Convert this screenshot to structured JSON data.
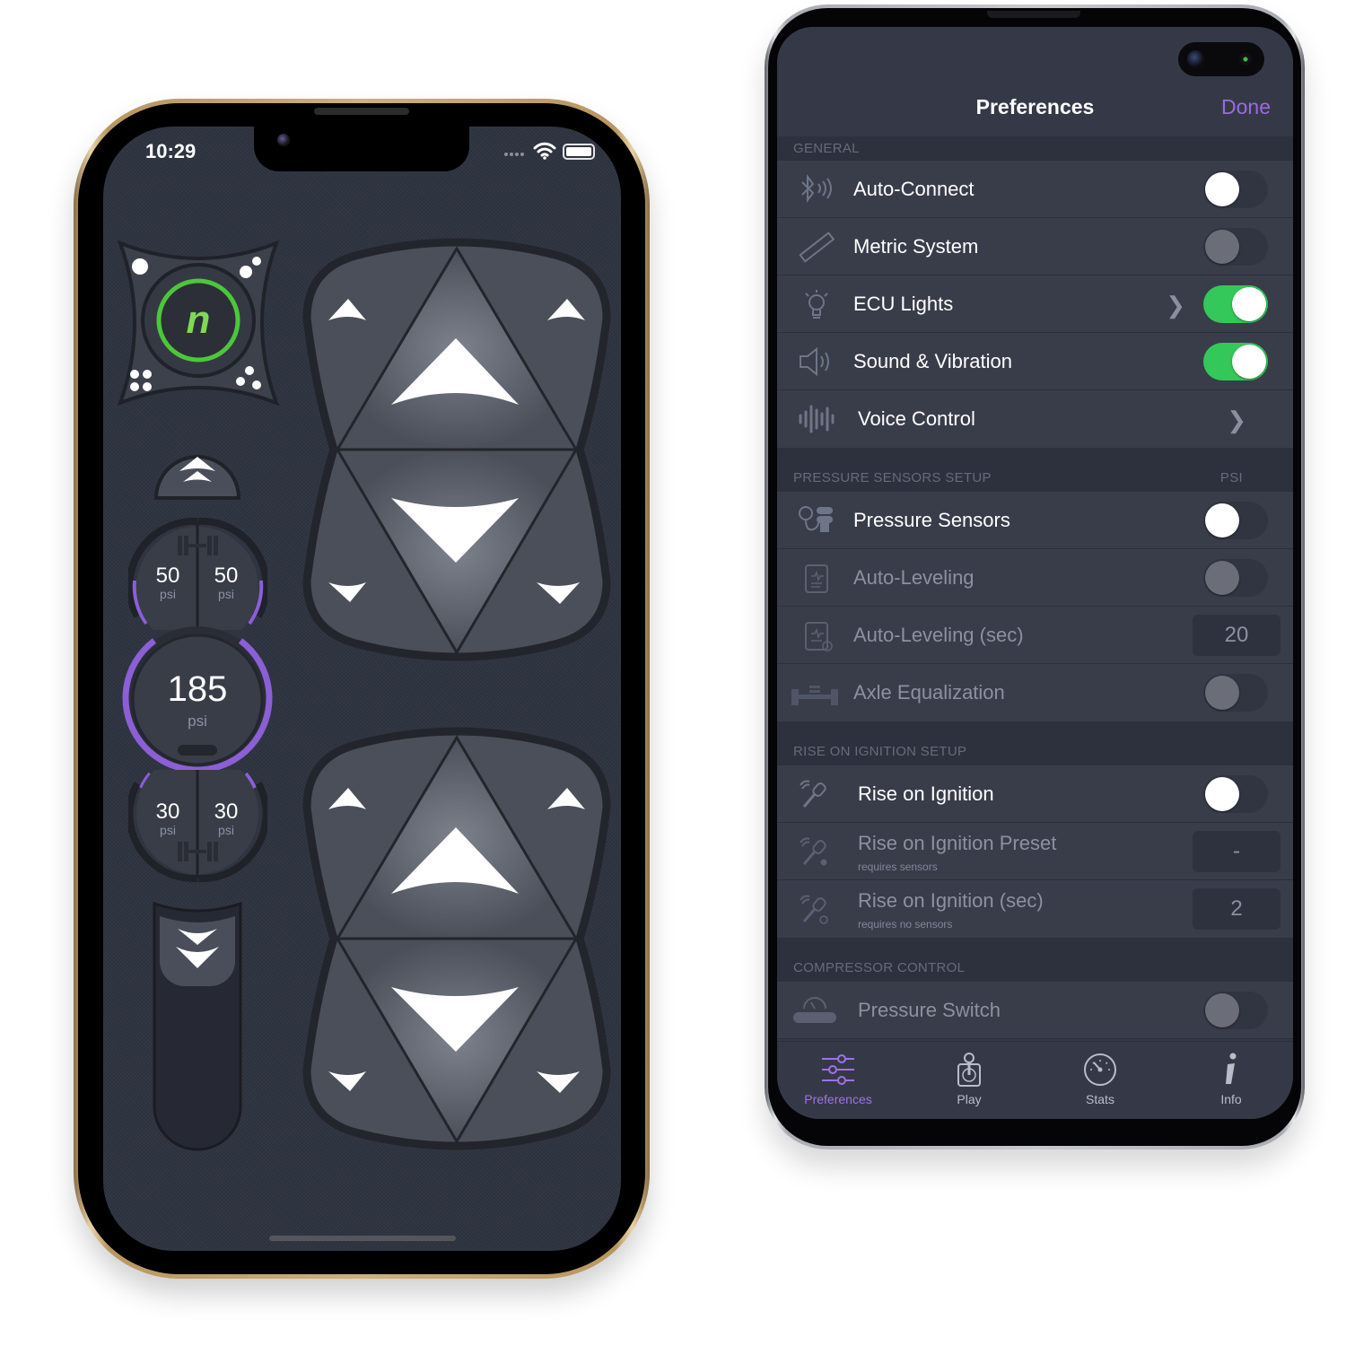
{
  "left_phone": {
    "status_bar": {
      "time": "10:29"
    },
    "logo_letter": "n",
    "front_left_pressure": {
      "value": "50",
      "unit": "psi"
    },
    "front_right_pressure": {
      "value": "50",
      "unit": "psi"
    },
    "tank_pressure": {
      "value": "185",
      "unit": "psi"
    },
    "rear_left_pressure": {
      "value": "30",
      "unit": "psi"
    },
    "rear_right_pressure": {
      "value": "30",
      "unit": "psi"
    },
    "accent_color": "#8b5fd6",
    "logo_ring_color": "#4cc73a"
  },
  "right_phone": {
    "nav": {
      "title": "Preferences",
      "done_label": "Done"
    },
    "sections": [
      {
        "header": "GENERAL",
        "header_right": "",
        "rows": [
          {
            "label": "Auto-Connect",
            "icon": "bluetooth-icon",
            "control": "toggle",
            "state": "off",
            "enabled": true
          },
          {
            "label": "Metric System",
            "icon": "ruler-icon",
            "control": "toggle",
            "state": "off",
            "enabled": false
          },
          {
            "label": "ECU Lights",
            "icon": "lightbulb-icon",
            "control": "toggle",
            "state": "on",
            "chevron": true,
            "enabled": true
          },
          {
            "label": "Sound & Vibration",
            "icon": "speaker-icon",
            "control": "toggle",
            "state": "on",
            "enabled": true
          },
          {
            "label": "Voice Control",
            "icon": "waveform-icon",
            "control": "chevron",
            "enabled": true
          }
        ]
      },
      {
        "header": "PRESSURE SENSORS SETUP",
        "header_right": "PSI",
        "rows": [
          {
            "label": "Pressure Sensors",
            "icon": "pressure-sensor-icon",
            "control": "toggle",
            "state": "off",
            "enabled": true
          },
          {
            "label": "Auto-Leveling",
            "icon": "clipboard-icon",
            "control": "toggle",
            "state": "off",
            "enabled": false
          },
          {
            "label": "Auto-Leveling (sec)",
            "icon": "clipboard-timer-icon",
            "control": "value",
            "value": "20",
            "enabled": false
          },
          {
            "label": "Axle Equalization",
            "icon": "axle-icon",
            "control": "toggle",
            "state": "off",
            "enabled": false
          }
        ]
      },
      {
        "header": "RISE ON IGNITION SETUP",
        "header_right": "",
        "rows": [
          {
            "label": "Rise on Ignition",
            "icon": "key-icon",
            "control": "toggle",
            "state": "off",
            "enabled": true
          },
          {
            "label": "Rise on Ignition Preset",
            "sublabel": "requires sensors",
            "icon": "key-dot-icon",
            "control": "value",
            "value": "-",
            "enabled": false
          },
          {
            "label": "Rise on Ignition (sec)",
            "sublabel": "requires no sensors",
            "icon": "key-timer-icon",
            "control": "value",
            "value": "2",
            "enabled": false
          }
        ]
      },
      {
        "header": "COMPRESSOR CONTROL",
        "header_right": "",
        "rows": [
          {
            "label": "Pressure Switch",
            "icon": "compressor-icon",
            "control": "toggle",
            "state": "off",
            "enabled": false
          }
        ]
      }
    ],
    "tabs": [
      {
        "label": "Preferences",
        "icon": "sliders-icon",
        "active": true
      },
      {
        "label": "Play",
        "icon": "joystick-icon",
        "active": false
      },
      {
        "label": "Stats",
        "icon": "gauge-icon",
        "active": false
      },
      {
        "label": "Info",
        "icon": "info-icon",
        "active": false
      }
    ],
    "colors": {
      "accent": "#9b6ae0",
      "toggle_on": "#34c759",
      "background": "#353947"
    }
  }
}
